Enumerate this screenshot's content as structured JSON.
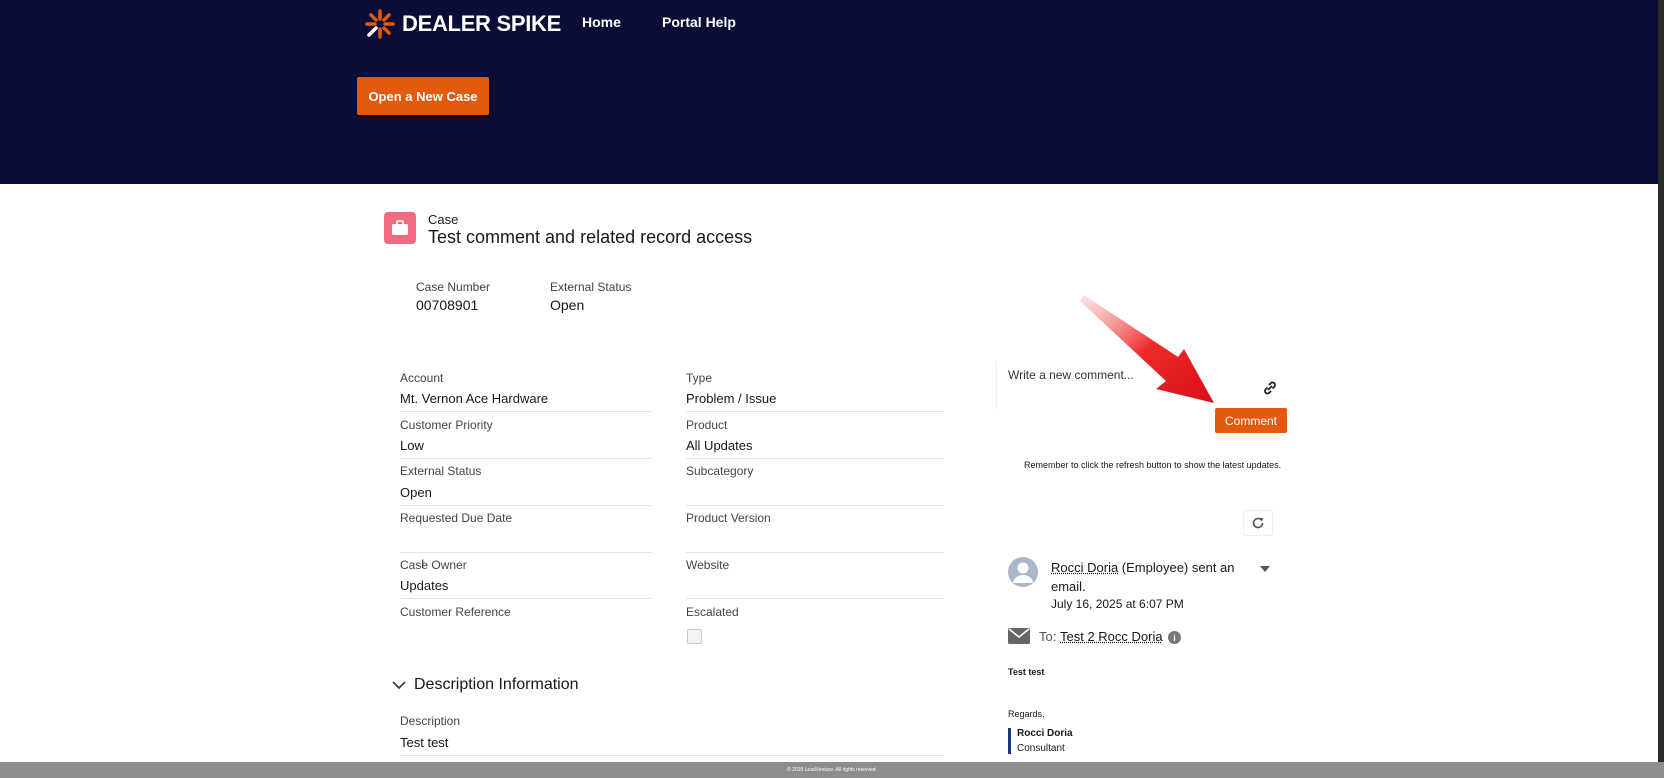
{
  "header": {
    "logo_text": "DEALER SPIKE",
    "nav": [
      "Home",
      "Portal Help"
    ],
    "new_case_label": "Open a New Case"
  },
  "case": {
    "object_label": "Case",
    "title": "Test comment and related record access",
    "highlights": {
      "case_number_label": "Case Number",
      "case_number": "00708901",
      "external_status_label": "External Status",
      "external_status": "Open"
    }
  },
  "fields": {
    "account_label": "Account",
    "account": "Mt. Vernon Ace Hardware",
    "type_label": "Type",
    "type": "Problem / Issue",
    "customer_priority_label": "Customer Priority",
    "customer_priority": "Low",
    "product_label": "Product",
    "product": "All Updates",
    "external_status_label": "External Status",
    "external_status": "Open",
    "subcategory_label": "Subcategory",
    "subcategory": "",
    "requested_due_date_label": "Requested Due Date",
    "requested_due_date": "",
    "product_version_label": "Product Version",
    "product_version": "",
    "case_owner_label": "Case Owner",
    "case_owner": "Updates",
    "website_label": "Website",
    "website": "",
    "customer_reference_label": "Customer Reference",
    "customer_reference": "",
    "escalated_label": "Escalated",
    "escalated": false
  },
  "description": {
    "section_title": "Description Information",
    "label": "Description",
    "value": "Test test"
  },
  "feed": {
    "comment_placeholder": "Write a new comment...",
    "comment_button": "Comment",
    "reminder": "Remember to click the refresh button to show the latest updates.",
    "post": {
      "author": "Rocci Doria",
      "author_suffix": " (Employee) sent an email.",
      "date": "July 16, 2025 at 6:07 PM",
      "to_label": "To:",
      "to_name": "Test 2 Rocc Doria",
      "body": "Test test",
      "regards": "Regards,",
      "sig_name": "Rocci Doria",
      "sig_title": "Consultant"
    }
  },
  "footer": {
    "text": "© 2025 LeadVenture. All rights reserved."
  },
  "colors": {
    "header_bg": "#0a0d36",
    "accent": "#e35a0f",
    "case_icon": "#f06a84",
    "arrow": "#e8171f"
  }
}
